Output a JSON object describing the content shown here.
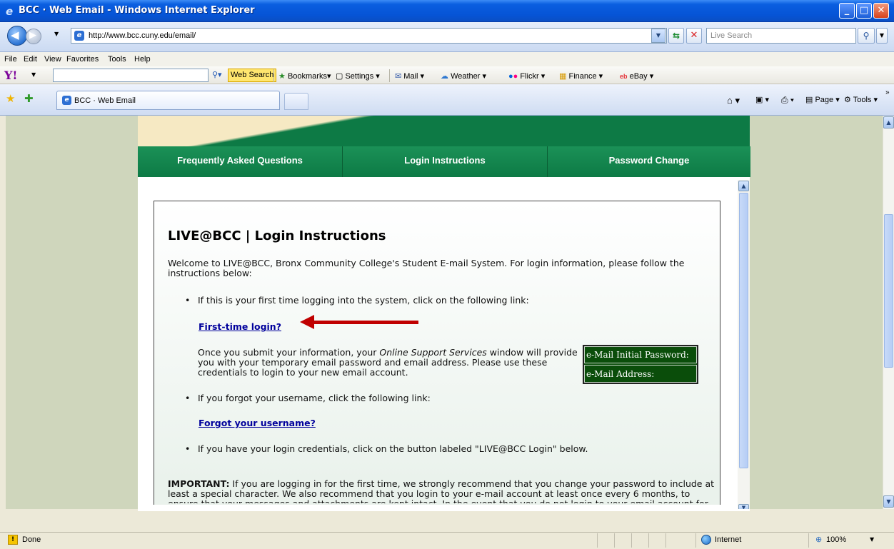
{
  "window": {
    "title": "BCC · Web Email - Windows Internet Explorer"
  },
  "address": {
    "url": "http://www.bcc.cuny.edu/email/"
  },
  "search": {
    "placeholder": "Live Search"
  },
  "menu": [
    "File",
    "Edit",
    "View",
    "Favorites",
    "Tools",
    "Help"
  ],
  "yahoo_toolbar": {
    "web_search": "Web Search",
    "items": [
      "Bookmarks▾",
      "Settings ▾",
      "Mail ▾",
      "Weather ▾",
      "Flickr ▾",
      "Finance ▾",
      "eBay ▾"
    ]
  },
  "tab": {
    "title": "BCC · Web Email"
  },
  "commands": {
    "page": "Page ▾",
    "tools": "Tools ▾"
  },
  "page": {
    "nav": [
      "Frequently Asked Questions",
      "Login Instructions",
      "Password Change"
    ],
    "heading": "LIVE@BCC | Login Instructions",
    "intro": "Welcome to LIVE@BCC, Bronx Community College's Student E-mail System. For login information, please follow the instructions below:",
    "bullet1": "If this is your first time logging into the system, click on the following link:",
    "link1": "First-time login?",
    "para_before": "Once you submit your information, your ",
    "para_italic": "Online Support Services",
    "para_after": " window will provide you with your temporary email password and email address. Please use these credentials to login to your new email account.",
    "green_row1": "e-Mail Initial Password:",
    "green_row2": "e-Mail Address:",
    "bullet2": "If you forgot your username, click the following link:",
    "link2": "Forgot your username?",
    "bullet3": "If you have your login credentials, click on the button labeled \"LIVE@BCC Login\" below.",
    "important_label": "IMPORTANT:",
    "important_text": " If you are logging in for the first time, we strongly recommend that you change your password to include at least a special character. We also recommend that you login to your e-mail account at least once every 6 months, to ensure that your messages and attachments are kept intact. In the event that you do not login to your email account for an extended period of time, it will be disabled."
  },
  "status": {
    "text": "Done",
    "zone": "Internet",
    "zoom": "100%"
  }
}
